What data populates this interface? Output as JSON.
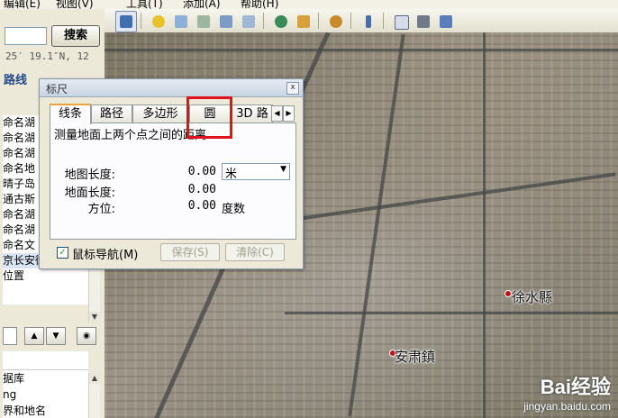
{
  "menu": {
    "items": [
      "编辑(E)",
      "视图(V)",
      "工具(T)",
      "添加(A)",
      "帮助(H)"
    ]
  },
  "left": {
    "search_button": "搜索",
    "coordinate": "25′ 19.1″N, 12",
    "route_tab": "路线",
    "places": [
      "命名湖",
      "命名湖",
      "命名湖",
      "命名地",
      "晴子岛",
      "通古斯",
      "命名湖",
      "命名湖",
      "命名文",
      "京长安街",
      "位置"
    ],
    "layers": [
      "据库",
      "ng",
      "界和地名"
    ]
  },
  "dialog": {
    "title": "标尺",
    "close": "x",
    "tabs": [
      "线条",
      "路径",
      "多边形",
      "圆",
      "3D 路"
    ],
    "description": "测量地面上两个点之间的距离",
    "map_length_label": "地图长度:",
    "map_length_value": "0.00",
    "unit_selected": "米",
    "ground_length_label": "地面长度:",
    "ground_length_value": "0.00",
    "heading_label": "方位:",
    "heading_value": "0.00",
    "heading_unit": "度数",
    "mouse_nav_label": "鼠标导航(M)",
    "mouse_nav_checked": true,
    "save_button": "保存(S)",
    "clear_button": "清除(C)"
  },
  "map": {
    "places": [
      "徐水縣",
      "安肃鎮"
    ],
    "watermark_logo": "Bai经验",
    "watermark_url": "jingyan.baidu.com"
  },
  "colors": {
    "highlight": "#e0131c",
    "active_tab_accent": "#e8a33c"
  }
}
